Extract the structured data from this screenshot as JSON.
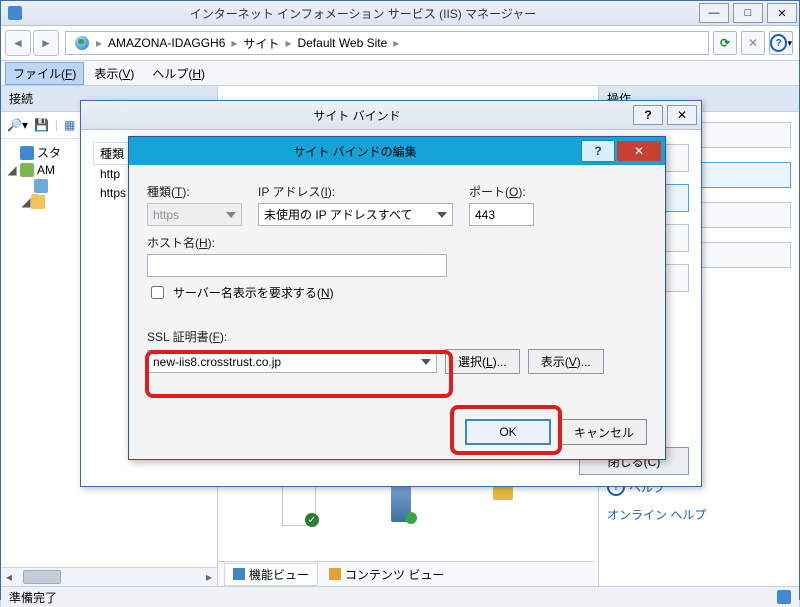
{
  "app": {
    "title": "インターネット インフォメーション サービス (IIS) マネージャー"
  },
  "breadcrumb": {
    "items": [
      "AMAZONA-IDAGGH6",
      "サイト",
      "Default Web Site"
    ]
  },
  "menu": {
    "file": "ファイル(F)",
    "view": "表示(V)",
    "help": "ヘルプ(H)"
  },
  "left": {
    "header": "接続",
    "nodes": {
      "start": "スタ",
      "server": "AM",
      "http": "http",
      "https": "https"
    }
  },
  "center": {
    "tabs": {
      "features": "機能ビュー",
      "content": "コンテンツ ビュー"
    }
  },
  "right": {
    "header": "操作",
    "close": "閉じる(C)",
    "help": "ヘルプ",
    "online_help": "オンライン ヘルプ"
  },
  "status": {
    "ready": "準備完了"
  },
  "bindings_dialog": {
    "title": "サイト バインド",
    "columns": {
      "type": "種類"
    },
    "rows": [
      "http",
      "https"
    ]
  },
  "edit_dialog": {
    "title": "サイト バインドの編集",
    "labels": {
      "type": "種類(T):",
      "ip": "IP アドレス(I):",
      "port": "ポート(O):",
      "host": "ホスト名(H):",
      "sni": "サーバー名表示を要求する(N)",
      "ssl_cert": "SSL 証明書(F):"
    },
    "values": {
      "type": "https",
      "ip": "未使用の IP アドレスすべて",
      "port": "443",
      "host": "",
      "ssl_cert": "new-iis8.crosstrust.co.jp"
    },
    "buttons": {
      "select": "選択(L)...",
      "view": "表示(V)...",
      "ok": "OK",
      "cancel": "キャンセル"
    }
  }
}
